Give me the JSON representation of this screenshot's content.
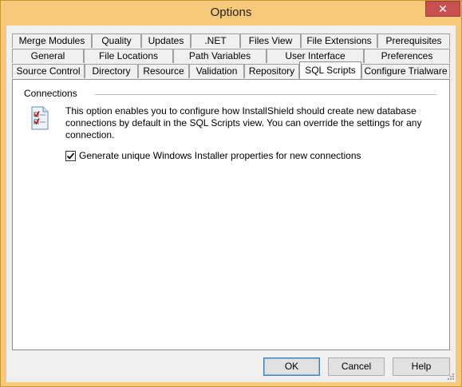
{
  "window": {
    "title": "Options",
    "close_glyph": "✕"
  },
  "tabs": {
    "row1": [
      "Merge Modules",
      "Quality",
      "Updates",
      ".NET",
      "Files View",
      "File Extensions",
      "Prerequisites"
    ],
    "row2": [
      "General",
      "File Locations",
      "Path Variables",
      "User Interface",
      "Preferences"
    ],
    "row3": [
      "Source Control",
      "Directory",
      "Resource",
      "Validation",
      "Repository",
      "SQL Scripts",
      "Configure Trialware"
    ],
    "active": "SQL Scripts"
  },
  "panel": {
    "group_label": "Connections",
    "icon": "checklist-icon",
    "description": "This option enables you to configure how InstallShield should create new database connections by default in the SQL Scripts view. You can override the settings for any connection.",
    "checkbox": {
      "label": "Generate unique Windows Installer properties for new connections",
      "checked": true
    }
  },
  "buttons": {
    "ok": "OK",
    "cancel": "Cancel",
    "help": "Help"
  },
  "colors": {
    "titlebar": "#f6c97b",
    "close": "#c75050",
    "default_button_border": "#3c7fb1"
  }
}
